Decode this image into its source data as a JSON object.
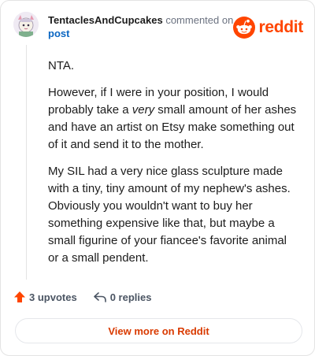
{
  "header": {
    "author": "TentaclesAndCupcakes",
    "action_text": "commented on",
    "post_link": "post"
  },
  "brand": {
    "wordmark": "reddit",
    "color": "#ff4500"
  },
  "comment": {
    "paragraphs": [
      {
        "segments": [
          {
            "text": "NTA."
          }
        ]
      },
      {
        "segments": [
          {
            "text": "However, if I were in your position, I would probably take a "
          },
          {
            "text": "very",
            "italic": true
          },
          {
            "text": " small amount of her ashes and have an artist on Etsy make something out of it and send it to the mother."
          }
        ]
      },
      {
        "segments": [
          {
            "text": "My SIL had a very nice glass sculpture made with a tiny, tiny amount of my nephew's ashes. Obviously you wouldn't want to buy her something expensive like that, but maybe a small figurine of your fiancee's favorite animal or a small pendent."
          }
        ]
      }
    ]
  },
  "actions": {
    "upvotes_label": "3 upvotes",
    "replies_label": "0 replies",
    "upvote_icon": "upvote-arrow-icon",
    "reply_icon": "reply-arrow-icon"
  },
  "footer": {
    "view_more_label": "View more on Reddit"
  },
  "colors": {
    "accent": "#ff4500",
    "link": "#0a66c2",
    "view_more_text": "#d93a00"
  }
}
